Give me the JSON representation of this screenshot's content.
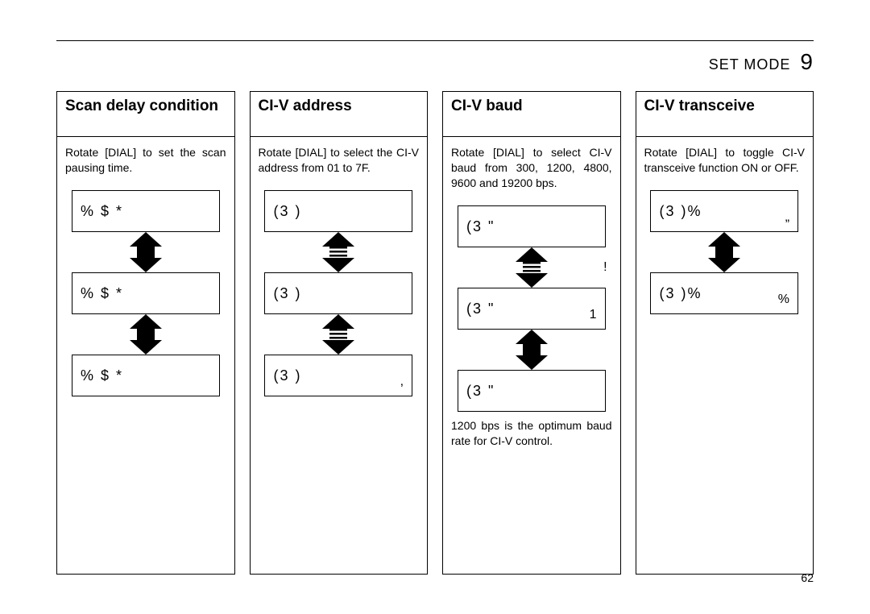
{
  "header": {
    "section": "SET MODE",
    "chapter": "9"
  },
  "columns": [
    {
      "title": "Scan delay condition",
      "desc": "Rotate [DIAL] to set the scan pausing time.",
      "options": [
        {
          "label": "% $ *",
          "right": ""
        },
        {
          "label": "% $ *",
          "right": ""
        },
        {
          "label": "% $ *",
          "right": ""
        }
      ],
      "arrows": [
        "solid",
        "solid"
      ],
      "note": ""
    },
    {
      "title": "CI-V address",
      "desc": "Rotate [DIAL] to select the CI-V address from 01 to 7F.",
      "options": [
        {
          "label": "(3  )",
          "right": ""
        },
        {
          "label": "(3  )",
          "right": ""
        },
        {
          "label": "(3  )",
          "right": ","
        }
      ],
      "arrows": [
        "stripe",
        "stripe"
      ],
      "note": ""
    },
    {
      "title": "CI-V baud",
      "desc": "Rotate [DIAL] to select CI-V baud from 300, 1200, 4800, 9600 and 19200 bps.",
      "options": [
        {
          "label": "(3  \"",
          "right": ""
        },
        {
          "label": "(3  \"",
          "right": "1"
        },
        {
          "label": "(3  \"",
          "right": ""
        }
      ],
      "arrows": [
        "stripe",
        "solid"
      ],
      "sideLabel": "!",
      "note": "1200 bps is the optimum baud rate for CI-V control."
    },
    {
      "title": "CI-V transceive",
      "desc": "Rotate [DIAL] to toggle CI-V transceive function ON or OFF.",
      "options": [
        {
          "label": "(3  )%",
          "right": "„"
        },
        {
          "label": "(3  )%",
          "right": "%"
        }
      ],
      "arrows": [
        "solid"
      ],
      "note": ""
    }
  ],
  "pageNumber": "62"
}
